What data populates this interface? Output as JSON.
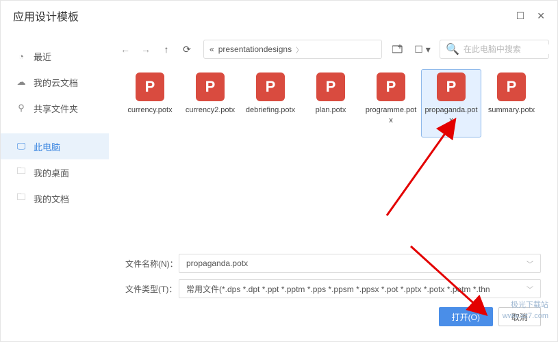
{
  "title": "应用设计模板",
  "sidebar": [
    {
      "icon": "clock",
      "label": "最近"
    },
    {
      "icon": "cloud",
      "label": "我的云文档"
    },
    {
      "icon": "share",
      "label": "共享文件夹"
    },
    {
      "icon": "monitor",
      "label": "此电脑",
      "active": true
    },
    {
      "icon": "folder",
      "label": "我的桌面"
    },
    {
      "icon": "folder",
      "label": "我的文档"
    }
  ],
  "path": {
    "prefix": "«",
    "folder": "presentationdesigns"
  },
  "search": {
    "placeholder": "在此电脑中搜索"
  },
  "files": [
    {
      "name": "currency.potx"
    },
    {
      "name": "currency2.potx"
    },
    {
      "name": "debriefing.potx"
    },
    {
      "name": "plan.potx"
    },
    {
      "name": "programme.potx"
    },
    {
      "name": "propaganda.potx",
      "selected": true
    },
    {
      "name": "summary.potx"
    }
  ],
  "filename": {
    "label": "文件名称(N)：",
    "value": "propaganda.potx"
  },
  "filetype": {
    "label": "文件类型(T)：",
    "value": "常用文件(*.dps *.dpt *.ppt *.pptm *.pps *.ppsm *.ppsx *.pot *.pptx *.potx *.potm *.thn"
  },
  "buttons": {
    "open": "打开(O)",
    "cancel": "取消"
  },
  "watermark": {
    "line1": "极光下载站",
    "line2": "www.xz7.com"
  }
}
